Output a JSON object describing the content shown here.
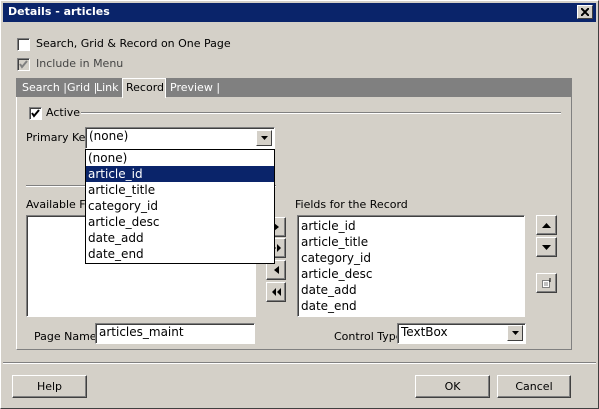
{
  "window": {
    "title": "Details - articles"
  },
  "options": {
    "one_page_label": "Search, Grid & Record on One Page",
    "one_page_checked": false,
    "include_menu_label": "Include in Menu",
    "include_menu_checked": true
  },
  "tabs": [
    {
      "label": "Search |"
    },
    {
      "label": "Grid |"
    },
    {
      "label": "Link"
    },
    {
      "label": "Record"
    },
    {
      "label": "Preview |"
    }
  ],
  "record": {
    "active_label": "Active",
    "active_checked": true,
    "primary_key_label": "Primary Key",
    "primary_key_value": "(none)",
    "primary_key_options": [
      "(none)",
      "article_id",
      "article_title",
      "category_id",
      "article_desc",
      "date_add",
      "date_end"
    ],
    "primary_key_highlighted": "article_id",
    "available_fields_label": "Available Fie",
    "record_fields_label": "Fields for the Record",
    "record_fields": [
      "article_id",
      "article_title",
      "category_id",
      "article_desc",
      "date_add",
      "date_end"
    ],
    "page_name_label": "Page Name",
    "page_name_value": "articles_maint",
    "control_type_label": "Control Type",
    "control_type_value": "TextBox"
  },
  "buttons": {
    "help": "Help",
    "ok": "OK",
    "cancel": "Cancel"
  },
  "colors": {
    "titlebar": "#0a246a",
    "face": "#d4d0c8",
    "selection": "#0a246a"
  }
}
